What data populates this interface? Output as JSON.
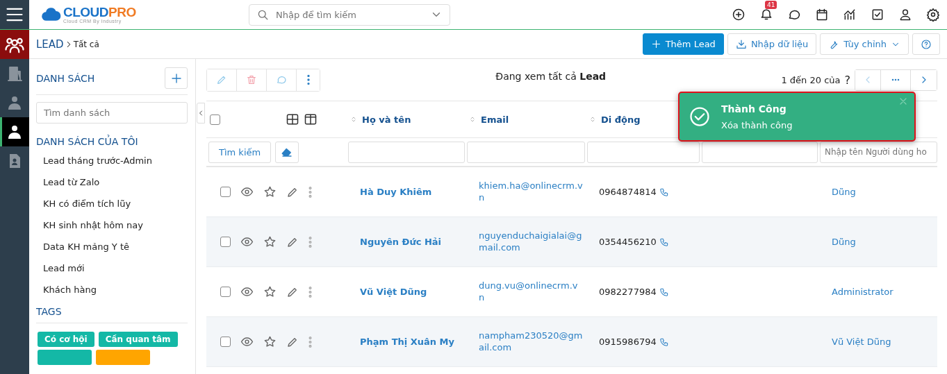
{
  "topbar": {
    "logo": {
      "main": "CLOUD",
      "accent": "PRO",
      "tagline": "Cloud CRM By Industry"
    },
    "search": {
      "placeholder": "Nhập để tìm kiếm"
    },
    "notification_count": "41"
  },
  "rail": [
    {
      "kind": "group",
      "selected": false
    },
    {
      "kind": "building",
      "selected": false
    },
    {
      "kind": "person-tie",
      "selected": false
    },
    {
      "kind": "person",
      "selected": true
    },
    {
      "kind": "contact",
      "selected": false
    }
  ],
  "breadcrumb": {
    "module": "LEAD",
    "current": "Tất cả"
  },
  "actions": [
    {
      "kind": "primary",
      "label": "Thêm Lead"
    },
    {
      "kind": "import",
      "label": "Nhập dữ liệu"
    },
    {
      "kind": "dropdown",
      "label": "Tùy chỉnh"
    },
    {
      "kind": "help"
    }
  ],
  "sidebar": {
    "title": "DANH SÁCH",
    "search": {
      "placeholder": "Tìm danh sách"
    },
    "section": "DANH SÁCH CỦA TÔI",
    "items": [
      "Lead tháng trước-Admin",
      "Lead từ Zalo",
      "KH có điểm tích lũy",
      "KH sinh nhật hôm nay",
      "Data KH mảng Y tê",
      "Lead mới",
      "Khách hàng"
    ],
    "tags_title": "TAGS",
    "tags": [
      {
        "label": "Có cơ hội",
        "color": "#14b8a6"
      },
      {
        "label": "Cần quan tâm",
        "color": "#14b8a6"
      },
      {
        "color": "#14b8a6"
      },
      {
        "color": "#ffa500"
      }
    ]
  },
  "main": {
    "viewing": "Đang xem tất cả **Lead**",
    "pager": {
      "range": "1 đến 20 của",
      "total": "?"
    },
    "header_checked": false,
    "columns": [
      "Họ và tên",
      "Email",
      "Di động"
    ],
    "search_button": "Tìm kiếm",
    "owner_filter": {
      "placeholder": "Nhập tên Người dùng ho"
    },
    "rows": [
      {
        "checked": false,
        "name": "Hà Duy Khiêm",
        "email": "khiem.ha@onlinecrm.vn",
        "mobile": "0964874814",
        "owner": "Dũng"
      },
      {
        "checked": false,
        "name": "Nguyên Đức Hải",
        "email": "nguyenduchaigialai@gmail.com",
        "mobile": "0354456210",
        "owner": "Dũng"
      },
      {
        "checked": false,
        "name": "Vũ Việt Dũng",
        "email": "dung.vu@onlinecrm.vn",
        "mobile": "0982277984",
        "owner": "Administrator"
      },
      {
        "checked": false,
        "name": "Phạm Thị Xuân My",
        "email": "nampham230520@gmail.com",
        "mobile": "0915986794",
        "owner": "Vũ Việt Dũng"
      }
    ]
  },
  "toast": {
    "title": "Thành Công",
    "message": "Xóa thành công"
  }
}
